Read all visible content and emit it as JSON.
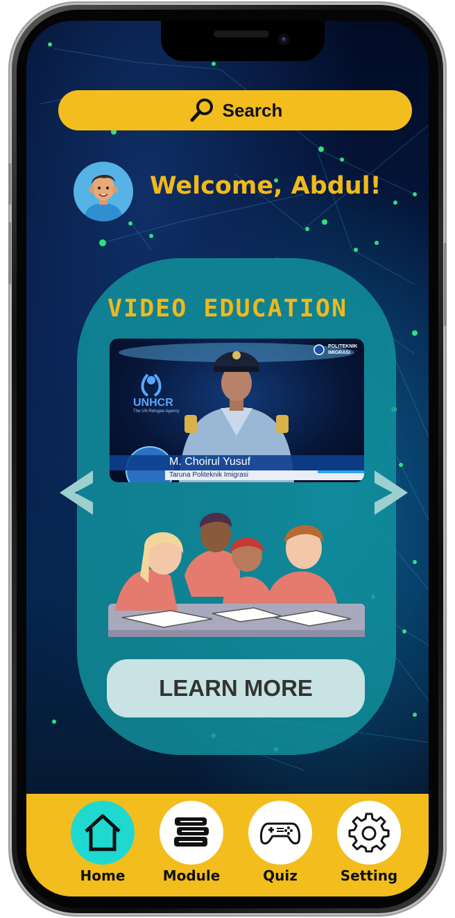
{
  "search": {
    "label": "Search",
    "icon": "search-icon"
  },
  "user": {
    "welcome": "Welcome, Abdul!",
    "avatar_icon": "avatar"
  },
  "section": {
    "title": "VIDEO EDUCATION"
  },
  "video": {
    "speaker_name": "M. Choirul Yusuf",
    "speaker_role": "Taruna Politeknik Imigrasi",
    "left_logo": "UNHCR",
    "left_logo_sub": "The UN Refugee Agency",
    "right_logo_line1": "POLITEKNIK",
    "right_logo_line2": "IMIGRASI"
  },
  "carousel": {
    "prev_icon": "chevron-left-icon",
    "next_icon": "chevron-right-icon"
  },
  "cta": {
    "learn_more": "LEARN MORE"
  },
  "nav": {
    "items": [
      {
        "label": "Home",
        "icon": "home-icon",
        "active": true
      },
      {
        "label": "Module",
        "icon": "books-icon",
        "active": false
      },
      {
        "label": "Quiz",
        "icon": "gamepad-icon",
        "active": false
      },
      {
        "label": "Setting",
        "icon": "gear-icon",
        "active": false
      }
    ]
  },
  "colors": {
    "accent_yellow": "#f2bd1d",
    "active_cyan": "#1fd9d1",
    "card_teal": "#1296a0",
    "background_navy": "#061a45"
  }
}
